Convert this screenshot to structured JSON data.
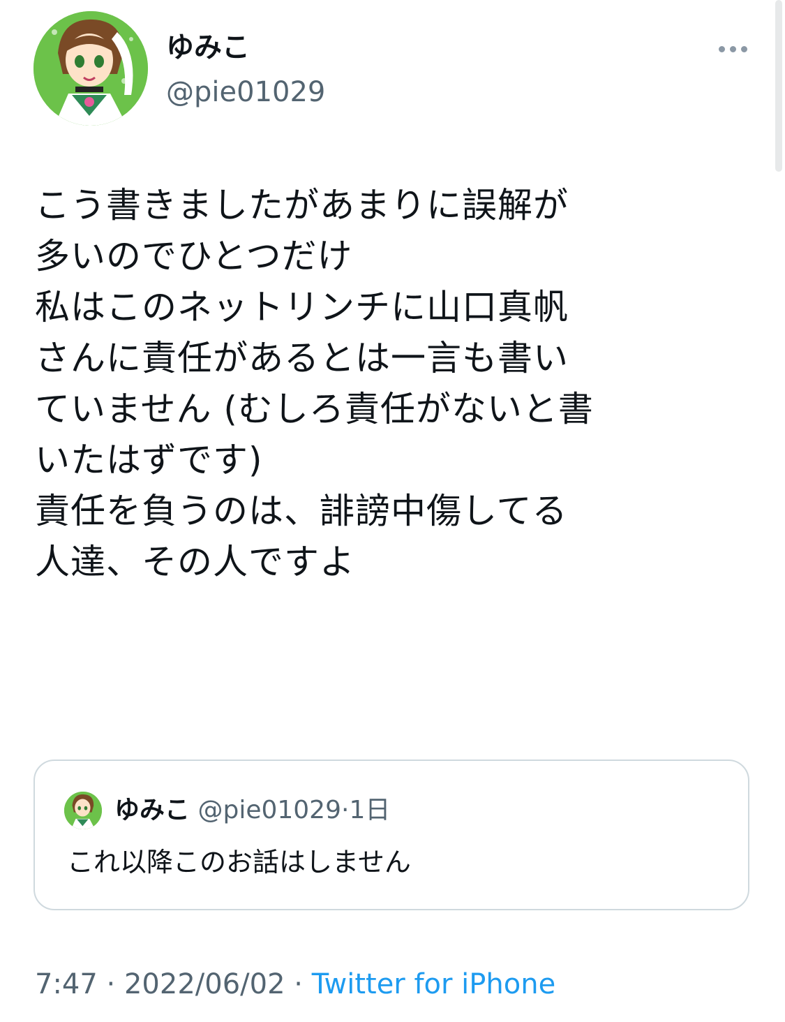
{
  "author": {
    "display_name": "ゆみこ",
    "handle": "@pie01029",
    "avatar_icon": "sailor-jupiter-avatar-icon"
  },
  "more_icon": "more-horizontal-icon",
  "tweet": {
    "lines": [
      "こう書きましたがあまりに誤解が",
      "多いのでひとつだけ",
      "私はこのネットリンチに山口真帆",
      "さんに責任があるとは一言も書い",
      "ていません (むしろ責任がないと書",
      "いたはずです)",
      "責任を負うのは、誹謗中傷してる",
      "人達、その人ですよ"
    ]
  },
  "quoted_tweet": {
    "display_name": "ゆみこ",
    "handle": "@pie01029",
    "separator": "·",
    "time": "1日",
    "text": "これ以降このお話はしません"
  },
  "meta": {
    "time": "7:47",
    "separator1": " · ",
    "date": "2022/06/02",
    "separator2": " · ",
    "source": "Twitter for iPhone"
  },
  "colors": {
    "text_primary": "#0f1419",
    "text_secondary": "#536471",
    "link": "#1d9bf0",
    "border": "#cfd9de",
    "avatar_bg": "#6cc24a"
  }
}
